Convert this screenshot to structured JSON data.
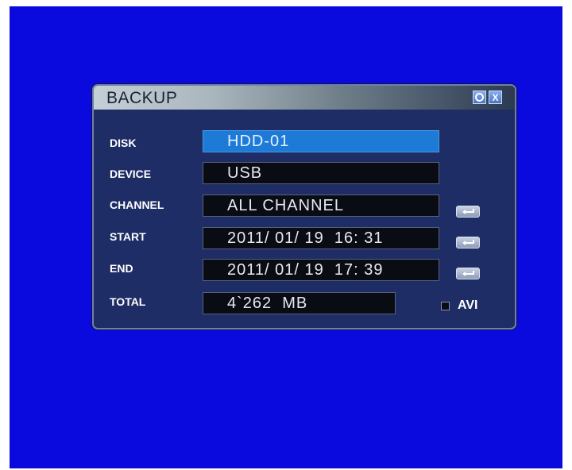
{
  "dialog": {
    "title": "BACKUP",
    "home_icon": "home-icon",
    "close_icon": "close-icon",
    "close_glyph": "X"
  },
  "rows": {
    "disk": {
      "label": "DISK",
      "value": "HDD-01"
    },
    "device": {
      "label": "DEVICE",
      "value": "USB"
    },
    "channel": {
      "label": "CHANNEL",
      "value": "ALL CHANNEL"
    },
    "start": {
      "label": "START",
      "value": "2011/ 01/ 19  16: 31"
    },
    "end": {
      "label": "END",
      "value": "2011/ 01/ 19  17: 39"
    },
    "total": {
      "label": "TOTAL",
      "value": "4`262  MB"
    }
  },
  "avi": {
    "label": "AVI",
    "checked": false
  },
  "colors": {
    "screen": "#0a0ade",
    "panel": "#1e2d66",
    "selected_field": "#1d7ad6",
    "field": "#0a0c14"
  }
}
